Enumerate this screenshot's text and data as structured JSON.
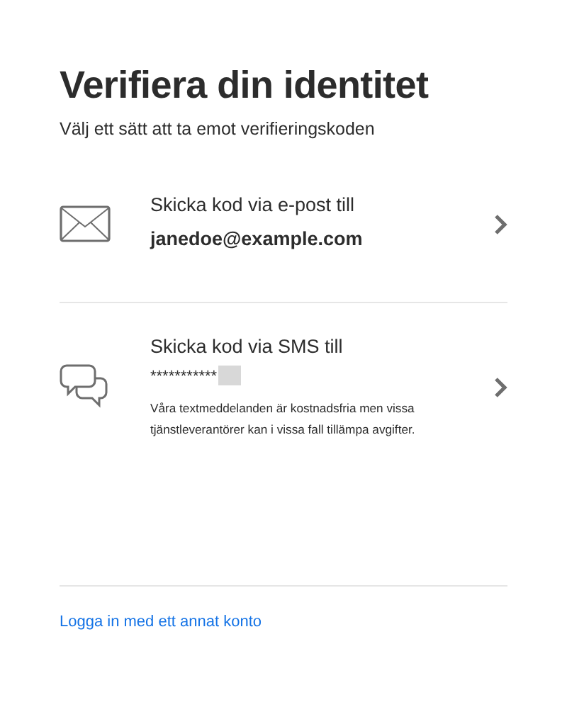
{
  "title": "Verifiera din identitet",
  "subtitle": "Välj ett sätt att ta emot verifieringskoden",
  "options": [
    {
      "kind": "email",
      "label": "Skicka kod via e-post till",
      "target": "janedoe@example.com"
    },
    {
      "kind": "sms",
      "label": "Skicka kod via SMS till",
      "target": "***********",
      "note": "Våra textmeddelanden är kostnadsfria men vissa tjänstleverantörer kan i vissa fall tillämpa avgifter."
    }
  ],
  "link": "Logga in med ett annat konto"
}
